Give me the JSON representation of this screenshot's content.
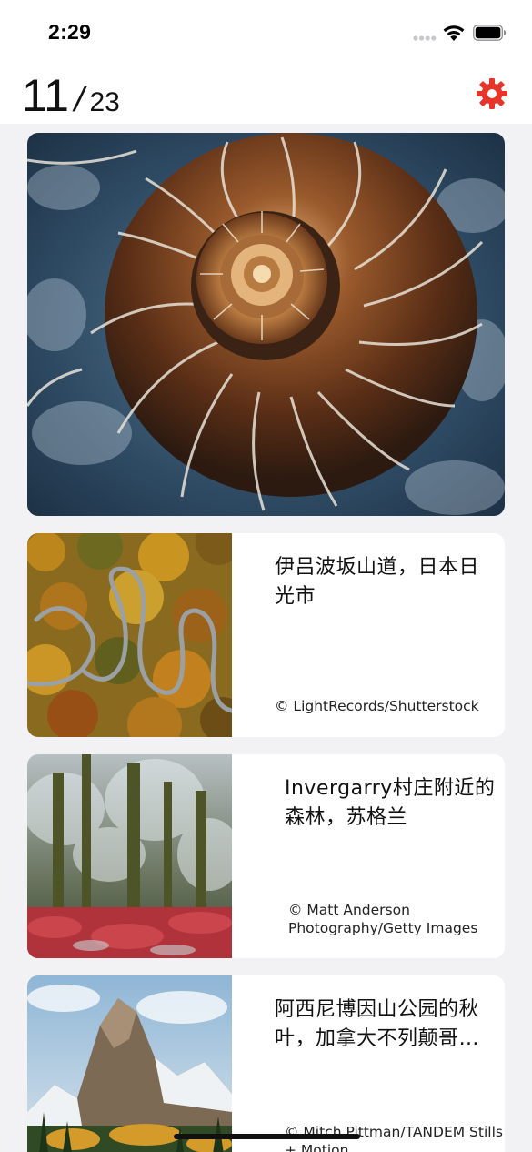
{
  "status_bar": {
    "time": "2:29"
  },
  "header": {
    "current": "11",
    "separator": "/",
    "total": "23",
    "settings_icon": "gear-icon",
    "accent_color": "#e8352a"
  },
  "hero": {
    "image": "ammonite-fossil-photo"
  },
  "stories": [
    {
      "title": "伊吕波坂山道，日本日光市",
      "credit": "© LightRecords/Shutterstock",
      "image": "winding-road-autumn-forest-photo"
    },
    {
      "title": "Invergarry村庄附近的森林，苏格兰",
      "credit": "© Matt Anderson Photography/Getty Images",
      "image": "frosted-forest-red-ferns-photo"
    },
    {
      "title": "阿西尼博因山公园的秋叶，加拿大不列颠哥…",
      "credit": "© Mitch Pittman/TANDEM Stills + Motion",
      "image": "mountain-peak-autumn-trees-photo"
    }
  ]
}
